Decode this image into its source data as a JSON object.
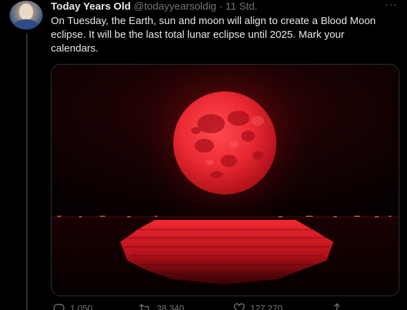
{
  "tweet": {
    "author_name": "Today Years Old",
    "author_handle": "@todayyearsoldig",
    "separator": "·",
    "timestamp": "11 Std.",
    "more_label": "···",
    "text": "On Tuesday, the Earth, sun and moon will align to create a Blood Moon eclipse. It will be the last total lunar eclipse until 2025. Mark your calendars.",
    "media_icon": "blood-moon-photo"
  },
  "actions": {
    "reply_count": "1.050",
    "retweet_count": "38.340",
    "like_count": "127.270",
    "reply_icon": "reply-icon",
    "retweet_icon": "retweet-icon",
    "like_icon": "heart-icon",
    "share_icon": "share-icon"
  },
  "colors": {
    "background": "#000000",
    "text_primary": "#e7e9ea",
    "text_secondary": "#71767b",
    "moon_red": "#e0262e"
  }
}
